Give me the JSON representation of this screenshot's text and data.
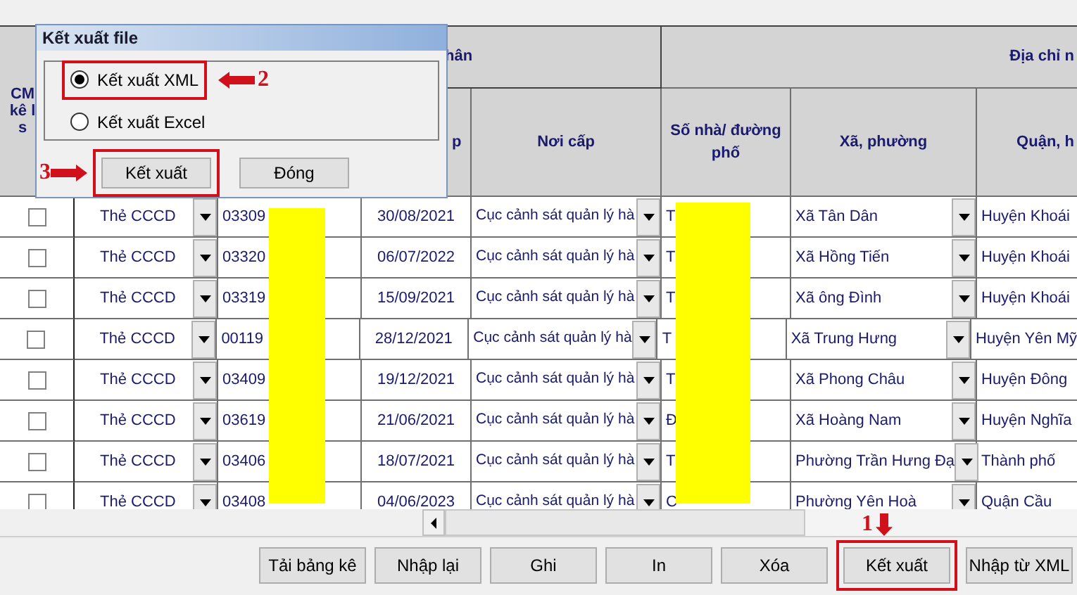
{
  "table": {
    "group_headers": [
      {
        "label": "CM\nkê l\ns"
      },
      {
        "label": "hân"
      },
      {
        "label": "Địa chỉ n"
      }
    ],
    "column_headers": [
      {
        "label": "p"
      },
      {
        "label": "Nơi cấp"
      },
      {
        "label": "Số nhà/ đường phố"
      },
      {
        "label": "Xã, phường"
      },
      {
        "label": "Quận, h"
      }
    ],
    "rows": [
      {
        "checked": false,
        "doc_type": "Thẻ CCCD",
        "id_number": "03309",
        "issue_date": "30/08/2021",
        "issued_by": "Cục cảnh sát quản lý hà",
        "house": "T",
        "ward": "Xã Tân Dân",
        "district": "Huyện Khoái"
      },
      {
        "checked": false,
        "doc_type": "Thẻ CCCD",
        "id_number": "03320",
        "issue_date": "06/07/2022",
        "issued_by": "Cục cảnh sát quản lý hà",
        "house": "T",
        "ward": "Xã Hồng Tiến",
        "district": "Huyện Khoái"
      },
      {
        "checked": false,
        "doc_type": "Thẻ CCCD",
        "id_number": "03319",
        "issue_date": "15/09/2021",
        "issued_by": "Cục cảnh sát quản lý hà",
        "house": "T",
        "ward": "Xã ông Đình",
        "district": "Huyện Khoái"
      },
      {
        "checked": false,
        "doc_type": "Thẻ CCCD",
        "id_number": "00119",
        "issue_date": "28/12/2021",
        "issued_by": "Cục cảnh sát quản lý hà",
        "house": "T",
        "ward": "Xã Trung Hưng",
        "district": "Huyện Yên Mỹ"
      },
      {
        "checked": false,
        "doc_type": "Thẻ CCCD",
        "id_number": "03409",
        "issue_date": "19/12/2021",
        "issued_by": "Cục cảnh sát quản lý hà",
        "house": "T",
        "ward": "Xã Phong Châu",
        "district": "Huyện Đông"
      },
      {
        "checked": false,
        "doc_type": "Thẻ CCCD",
        "id_number": "03619",
        "issue_date": "21/06/2021",
        "issued_by": "Cục cảnh sát quản lý hà",
        "house": "Đ",
        "ward": "Xã Hoàng Nam",
        "district": "Huyện Nghĩa"
      },
      {
        "checked": false,
        "doc_type": "Thẻ CCCD",
        "id_number": "03406",
        "issue_date": "18/07/2021",
        "issued_by": "Cục cảnh sát quản lý hà",
        "house": "T",
        "ward": "Phường Trần Hưng Đạ",
        "district": "Thành phố"
      },
      {
        "checked": false,
        "doc_type": "Thẻ CCCD",
        "id_number": "03408",
        "issue_date": "04/06/2023",
        "issued_by": "Cục cảnh sát quản lý hà",
        "house": "C",
        "ward": "Phường Yên Hoà",
        "district": "Quận Cầu"
      }
    ]
  },
  "buttons": [
    {
      "label": "Tải bảng kê",
      "highlighted": false
    },
    {
      "label": "Nhập lại",
      "highlighted": false
    },
    {
      "label": "Ghi",
      "highlighted": false
    },
    {
      "label": "In",
      "highlighted": false
    },
    {
      "label": "Xóa",
      "highlighted": false
    },
    {
      "label": "Kết xuất",
      "highlighted": true,
      "step": "1"
    },
    {
      "label": "Nhập từ XML",
      "highlighted": false
    }
  ],
  "dialog": {
    "title": "Kết xuất file",
    "options": [
      {
        "label": "Kết xuất XML",
        "selected": true,
        "highlighted": true,
        "step": "2"
      },
      {
        "label": "Kết xuất Excel",
        "selected": false,
        "highlighted": false
      }
    ],
    "buttons": [
      {
        "label": "Kết xuất",
        "highlighted": true,
        "step": "3"
      },
      {
        "label": "Đóng",
        "highlighted": false
      }
    ]
  }
}
